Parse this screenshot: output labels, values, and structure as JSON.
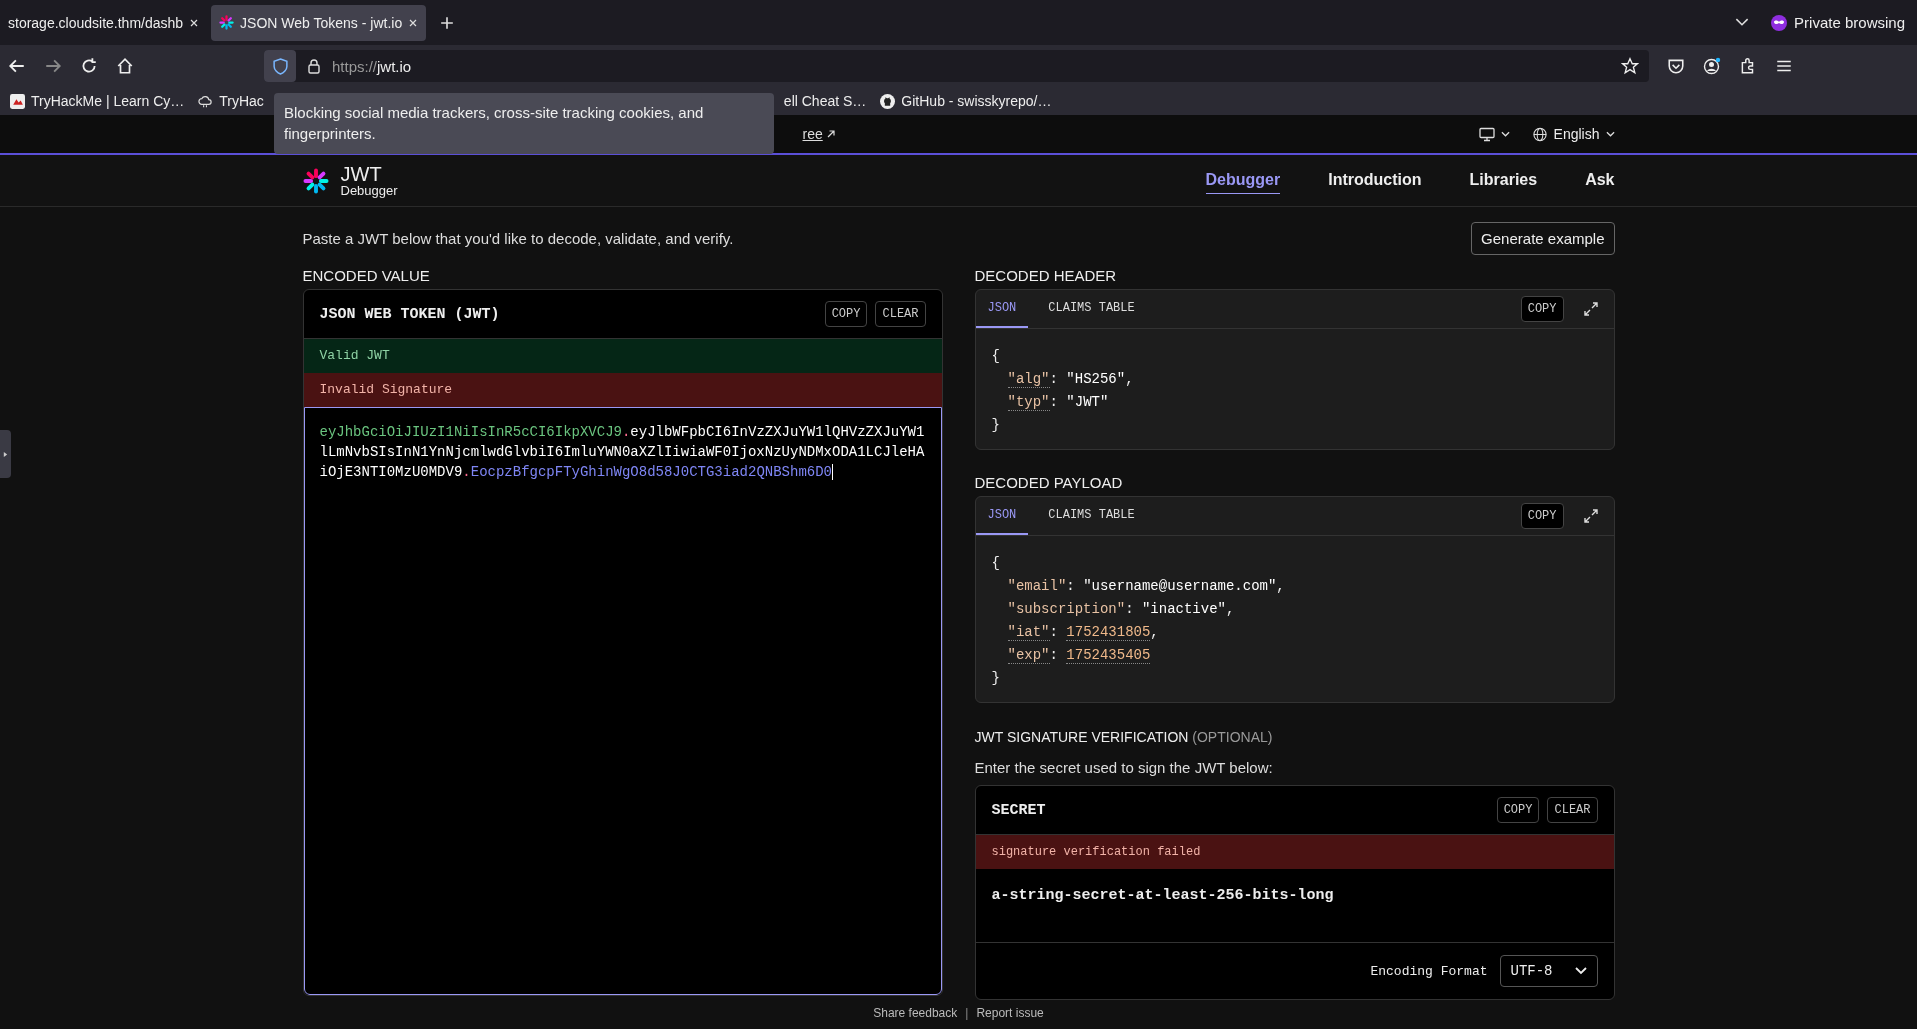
{
  "browser": {
    "tabs": [
      {
        "title": "storage.cloudsite.thm/dashb",
        "selected": false
      },
      {
        "title": "JSON Web Tokens - jwt.io",
        "selected": true
      }
    ],
    "private_label": "Private browsing",
    "url": {
      "scheme": "https://",
      "host": "jwt.io"
    },
    "bookmarks": [
      {
        "text": "TryHackMe | Learn Cy…",
        "kind": "site"
      },
      {
        "text": "TryHac",
        "kind": "cloud"
      },
      {
        "text": "ell Cheat S…",
        "kind": "plain"
      },
      {
        "text": "GitHub - swisskyrepo/…",
        "kind": "github"
      }
    ],
    "tooltip": "Blocking social media trackers, cross-site tracking cookies, and fingerprinters."
  },
  "banner": {
    "link": "ree",
    "language": "English"
  },
  "header": {
    "logo_title": "JWT",
    "logo_subtitle": "Debugger",
    "nav": [
      {
        "label": "Debugger",
        "selected": true
      },
      {
        "label": "Introduction",
        "selected": false
      },
      {
        "label": "Libraries",
        "selected": false
      },
      {
        "label": "Ask",
        "selected": false
      }
    ]
  },
  "intro": "Paste a JWT below that you'd like to decode, validate, and verify.",
  "generate_button": "Generate example",
  "encoded": {
    "section": "ENCODED VALUE",
    "title": "JSON WEB TOKEN (JWT)",
    "buttons": [
      "COPY",
      "CLEAR"
    ],
    "statuses": [
      {
        "text": "Valid JWT",
        "kind": "ok"
      },
      {
        "text": "Invalid Signature",
        "kind": "error"
      }
    ],
    "token": [
      {
        "kind": "header",
        "text": "eyJhbGciOiJIUzI1NiIsInR5cCI6IkpXVCJ9"
      },
      {
        "kind": "dot",
        "text": "."
      },
      {
        "kind": "payload",
        "text": "eyJlbWFpbCI6InVzZXJuYW1lQHVzZXJuYW1lLmNvbSIsInN1YnNjcmlwdGlvbiI6ImluYWN0aXZlIiwiaWF0IjoxNzUyNDMxODA1LCJleHAiOjE3NTI0MzU0MDV9"
      },
      {
        "kind": "dot",
        "text": "."
      },
      {
        "kind": "signature",
        "text": "EocpzBfgcpFTyGhinWgO8d58J0CTG3iad2QNBShm6D0"
      }
    ]
  },
  "decoded": [
    {
      "section": "DECODED HEADER",
      "tabs": [
        {
          "label": "JSON",
          "selected": true
        },
        {
          "label": "CLAIMS TABLE",
          "selected": false
        }
      ],
      "copy": "COPY",
      "lines": [
        {
          "kind": "brace",
          "text": "{"
        },
        {
          "kind": "string_pair",
          "key": "\"alg\"",
          "punct": ": ",
          "value": "\"HS256\"",
          "tail": ",",
          "claim": true
        },
        {
          "kind": "string_pair",
          "key": "\"typ\"",
          "punct": ": ",
          "value": "\"JWT\"",
          "claim": true
        },
        {
          "kind": "brace",
          "text": "}"
        }
      ]
    },
    {
      "section": "DECODED PAYLOAD",
      "tabs": [
        {
          "label": "JSON",
          "selected": true
        },
        {
          "label": "CLAIMS TABLE",
          "selected": false
        }
      ],
      "copy": "COPY",
      "lines": [
        {
          "kind": "brace",
          "text": "{"
        },
        {
          "kind": "string_pair",
          "key": "\"email\"",
          "punct": ": ",
          "value": "\"username@username.com\"",
          "tail": ",",
          "claim": false
        },
        {
          "kind": "string_pair",
          "key": "\"subscription\"",
          "punct": ": ",
          "value": "\"inactive\"",
          "tail": ",",
          "claim": false
        },
        {
          "kind": "number_pair",
          "key": "\"iat\"",
          "punct": ": ",
          "value": "1752431805",
          "tail": ",",
          "claim": true
        },
        {
          "kind": "number_pair",
          "key": "\"exp\"",
          "punct": ": ",
          "value": "1752435405",
          "claim": true
        },
        {
          "kind": "brace",
          "text": "}"
        }
      ]
    }
  ],
  "verification": {
    "title": "JWT SIGNATURE VERIFICATION",
    "optional": "(OPTIONAL)",
    "hint": "Enter the secret used to sign the JWT below:",
    "card_title": "SECRET",
    "buttons": [
      "COPY",
      "CLEAR"
    ],
    "status": "signature verification failed",
    "secret": "a-string-secret-at-least-256-bits-long",
    "encoding_label": "Encoding Format",
    "encoding": "UTF-8"
  },
  "footer": {
    "links": [
      "Share feedback",
      "Report issue"
    ],
    "separator": "|"
  }
}
